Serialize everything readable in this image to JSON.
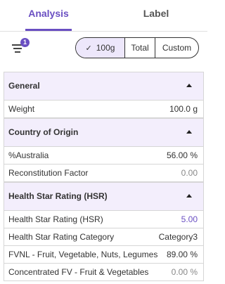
{
  "tabs": {
    "analysis": "Analysis",
    "label": "Label"
  },
  "toolbar": {
    "filter_badge": "1",
    "basis": {
      "per100g": "100g",
      "total": "Total",
      "custom": "Custom",
      "selected": "100g"
    }
  },
  "sections": {
    "general": {
      "title": "General",
      "rows": [
        {
          "label": "Weight",
          "value": "100.0 g"
        }
      ]
    },
    "origin": {
      "title": "Country of Origin",
      "rows": [
        {
          "label": "%Australia",
          "value": "56.00 %"
        },
        {
          "label": "Reconstitution Factor",
          "value": "0.00"
        }
      ]
    },
    "hsr": {
      "title": "Health Star Rating (HSR)",
      "rows": [
        {
          "label": "Health Star Rating (HSR)",
          "value": "5.00"
        },
        {
          "label": "Health Star Rating Category",
          "value": "Category3"
        },
        {
          "label": "FVNL - Fruit, Vegetable, Nuts, Legumes",
          "value": "89.00 %"
        },
        {
          "label": "Concentrated FV - Fruit & Vegetables",
          "value": "0.00 %"
        }
      ]
    }
  },
  "colors": {
    "accent": "#6a4fc2",
    "header_bg": "#f3eefc",
    "active_seg_bg": "#ede7fb"
  }
}
